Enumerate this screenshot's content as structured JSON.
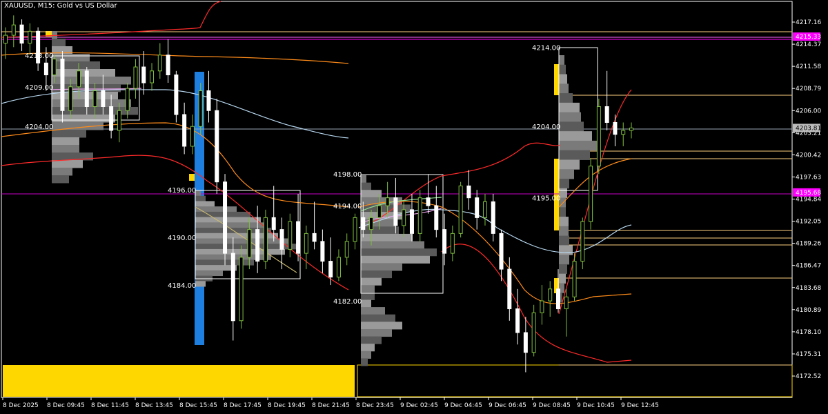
{
  "chart_title": "XAUUSD, M15:  Gold vs US Dollar",
  "chart_data": {
    "type": "candlestick",
    "symbol": "XAUUSD",
    "timeframe": "M15",
    "description": "Gold vs US Dollar",
    "ylim": [
      4170.5,
      4220.0
    ],
    "grid": false,
    "y_ticks": [
      "4217.16",
      "4214.37",
      "4211.58",
      "4208.79",
      "4206.00",
      "4203.21",
      "4200.42",
      "4197.63",
      "4194.84",
      "4192.05",
      "4189.26",
      "4186.47",
      "4183.68",
      "4180.89",
      "4178.10",
      "4175.31",
      "4172.52"
    ],
    "x_ticks": [
      "8 Dec 2025",
      "8 Dec 09:45",
      "8 Dec 11:45",
      "8 Dec 13:45",
      "8 Dec 15:45",
      "8 Dec 17:45",
      "8 Dec 19:45",
      "8 Dec 21:45",
      "8 Dec 23:45",
      "9 Dec 02:45",
      "9 Dec 04:45",
      "9 Dec 06:45",
      "9 Dec 08:45",
      "9 Dec 10:45",
      "9 Dec 12:45"
    ],
    "price_tags": [
      {
        "label": "4215.33",
        "value": 4215.33,
        "color": "#ff00ff"
      },
      {
        "label": "4203.81",
        "value": 4203.81,
        "color": "#bcbcbc"
      },
      {
        "label": "4195.68",
        "value": 4195.68,
        "color": "#ff00ff"
      }
    ],
    "volume_profile_labels": [
      {
        "label": "4213.00",
        "value": 4213.0
      },
      {
        "label": "4209.00",
        "value": 4209.0
      },
      {
        "label": "4204.00",
        "value": 4204.0
      },
      {
        "label": "4196.00",
        "value": 4196.0
      },
      {
        "label": "4190.00",
        "value": 4190.0
      },
      {
        "label": "4184.00",
        "value": 4184.0
      },
      {
        "label": "4198.00",
        "value": 4198.0
      },
      {
        "label": "4194.00",
        "value": 4194.0
      },
      {
        "label": "4182.00",
        "value": 4182.0
      },
      {
        "label": "4214.00",
        "value": 4214.0
      },
      {
        "label": "4204.00",
        "value": 4204.0
      },
      {
        "label": "4195.00",
        "value": 4195.0
      }
    ],
    "candles": [
      [
        4214.5,
        4216.5,
        4212.5,
        4215.5
      ],
      [
        4215.5,
        4218.0,
        4214.0,
        4216.8
      ],
      [
        4216.8,
        4217.5,
        4213.5,
        4214.5
      ],
      [
        4214.5,
        4217.0,
        4213.0,
        4216.0
      ],
      [
        4216.0,
        4216.5,
        4211.0,
        4212.0
      ],
      [
        4212.0,
        4214.0,
        4208.5,
        4210.5
      ],
      [
        4210.5,
        4213.0,
        4209.5,
        4212.5
      ],
      [
        4212.5,
        4213.5,
        4204.5,
        4206.0
      ],
      [
        4206.0,
        4210.0,
        4205.0,
        4209.0
      ],
      [
        4209.0,
        4212.0,
        4207.5,
        4211.0
      ],
      [
        4211.0,
        4211.5,
        4205.5,
        4206.5
      ],
      [
        4206.5,
        4209.5,
        4205.0,
        4208.5
      ],
      [
        4208.5,
        4210.5,
        4205.5,
        4206.5
      ],
      [
        4206.5,
        4208.0,
        4202.5,
        4203.5
      ],
      [
        4203.5,
        4207.0,
        4202.0,
        4206.0
      ],
      [
        4206.0,
        4209.5,
        4205.0,
        4208.8
      ],
      [
        4208.8,
        4212.5,
        4207.5,
        4211.5
      ],
      [
        4211.5,
        4213.5,
        4208.0,
        4209.5
      ],
      [
        4209.5,
        4212.0,
        4208.5,
        4211.0
      ],
      [
        4211.0,
        4214.5,
        4210.0,
        4213.0
      ],
      [
        4213.0,
        4215.0,
        4209.5,
        4210.5
      ],
      [
        4210.5,
        4211.0,
        4204.5,
        4205.5
      ],
      [
        4205.5,
        4207.0,
        4200.5,
        4201.5
      ],
      [
        4201.5,
        4205.5,
        4200.5,
        4204.0
      ],
      [
        4204.0,
        4209.5,
        4203.0,
        4208.5
      ],
      [
        4208.5,
        4211.0,
        4204.5,
        4206.0
      ],
      [
        4206.0,
        4207.5,
        4195.5,
        4197.0
      ],
      [
        4197.0,
        4198.0,
        4186.5,
        4188.0
      ],
      [
        4188.0,
        4190.0,
        4177.0,
        4179.5
      ],
      [
        4179.5,
        4189.0,
        4178.5,
        4187.5
      ],
      [
        4187.5,
        4192.5,
        4186.0,
        4191.0
      ],
      [
        4191.0,
        4194.0,
        4185.5,
        4187.0
      ],
      [
        4187.0,
        4193.5,
        4186.0,
        4192.5
      ],
      [
        4192.5,
        4196.5,
        4189.5,
        4191.0
      ],
      [
        4191.0,
        4192.5,
        4186.0,
        4188.5
      ],
      [
        4188.5,
        4193.0,
        4187.5,
        4192.0
      ],
      [
        4192.0,
        4195.5,
        4187.0,
        4188.0
      ],
      [
        4188.0,
        4191.5,
        4186.0,
        4190.5
      ],
      [
        4190.5,
        4194.5,
        4188.5,
        4189.5
      ],
      [
        4189.5,
        4191.0,
        4185.5,
        4187.0
      ],
      [
        4187.0,
        4190.0,
        4184.0,
        4185.0
      ],
      [
        4185.0,
        4188.5,
        4184.5,
        4187.5
      ],
      [
        4187.5,
        4190.5,
        4186.5,
        4189.5
      ],
      [
        4189.5,
        4193.0,
        4188.5,
        4192.5
      ],
      [
        4192.5,
        4194.5,
        4190.0,
        4191.0
      ],
      [
        4191.0,
        4193.5,
        4189.0,
        4192.5
      ],
      [
        4192.5,
        4195.5,
        4191.0,
        4194.0
      ],
      [
        4194.0,
        4197.0,
        4192.5,
        4195.0
      ],
      [
        4195.0,
        4197.5,
        4190.5,
        4191.5
      ],
      [
        4191.5,
        4194.5,
        4190.0,
        4193.5
      ],
      [
        4193.5,
        4195.5,
        4189.5,
        4190.5
      ],
      [
        4190.5,
        4196.0,
        4189.5,
        4195.0
      ],
      [
        4195.0,
        4198.0,
        4193.0,
        4194.0
      ],
      [
        4194.0,
        4196.5,
        4190.0,
        4191.0
      ],
      [
        4191.0,
        4193.0,
        4186.5,
        4188.0
      ],
      [
        4188.0,
        4191.5,
        4187.0,
        4190.5
      ],
      [
        4190.5,
        4197.0,
        4190.0,
        4196.5
      ],
      [
        4196.5,
        4198.5,
        4193.5,
        4195.0
      ],
      [
        4195.0,
        4196.0,
        4191.0,
        4192.5
      ],
      [
        4192.5,
        4195.5,
        4191.5,
        4194.5
      ],
      [
        4194.5,
        4195.5,
        4189.5,
        4190.5
      ],
      [
        4190.5,
        4191.0,
        4184.5,
        4186.0
      ],
      [
        4186.0,
        4187.5,
        4179.5,
        4181.0
      ],
      [
        4181.0,
        4183.5,
        4176.5,
        4178.0
      ],
      [
        4178.0,
        4180.0,
        4173.0,
        4175.5
      ],
      [
        4175.5,
        4181.5,
        4175.0,
        4180.5
      ],
      [
        4180.5,
        4184.0,
        4179.0,
        4182.0
      ],
      [
        4182.0,
        4184.5,
        4180.0,
        4183.5
      ],
      [
        4183.5,
        4186.0,
        4180.5,
        4181.0
      ],
      [
        4181.0,
        4183.5,
        4177.5,
        4182.5
      ],
      [
        4182.5,
        4188.0,
        4182.0,
        4187.0
      ],
      [
        4187.0,
        4192.5,
        4186.0,
        4192.0
      ],
      [
        4192.0,
        4200.0,
        4191.0,
        4199.0
      ],
      [
        4199.0,
        4207.5,
        4198.0,
        4206.5
      ],
      [
        4206.5,
        4211.0,
        4203.5,
        4204.5
      ],
      [
        4204.5,
        4205.5,
        4201.5,
        4203.0
      ],
      [
        4203.0,
        4204.5,
        4201.5,
        4203.5
      ],
      [
        4203.5,
        4204.5,
        4202.5,
        4203.8
      ]
    ]
  }
}
